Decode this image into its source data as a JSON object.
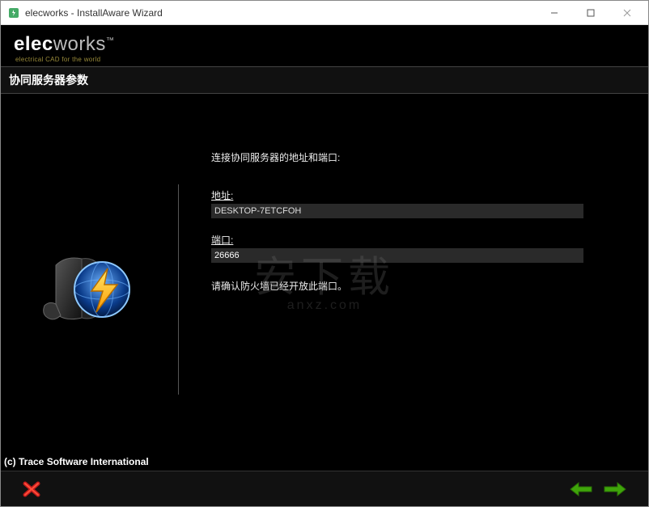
{
  "window": {
    "title": "elecworks - InstallAware Wizard"
  },
  "brand": {
    "part1": "elec",
    "part2": "works",
    "tm": "™",
    "tagline": "electrical CAD for the world"
  },
  "header": {
    "title": "协同服务器参数"
  },
  "form": {
    "prompt": "连接协同服务器的地址和端口:",
    "address_label": "地址:",
    "address_value": "DESKTOP-7ETCFOH",
    "port_label": "端口:",
    "port_value": "26666",
    "note": "请确认防火墙已经开放此端口。"
  },
  "watermark": {
    "main": "安下载",
    "sub": "anxz.com"
  },
  "copyright": "(c) Trace Software International",
  "icons": {
    "app": "app-icon",
    "minimize": "minimize-icon",
    "maximize": "maximize-icon",
    "close": "close-icon",
    "hero": "server-lightning-icon",
    "cancel": "cancel-x-icon",
    "back": "arrow-left-icon",
    "next": "arrow-right-icon"
  },
  "colors": {
    "accent_green": "#3fa50a",
    "cancel_red": "#c21b1b",
    "input_bg": "#2a2a2a"
  }
}
